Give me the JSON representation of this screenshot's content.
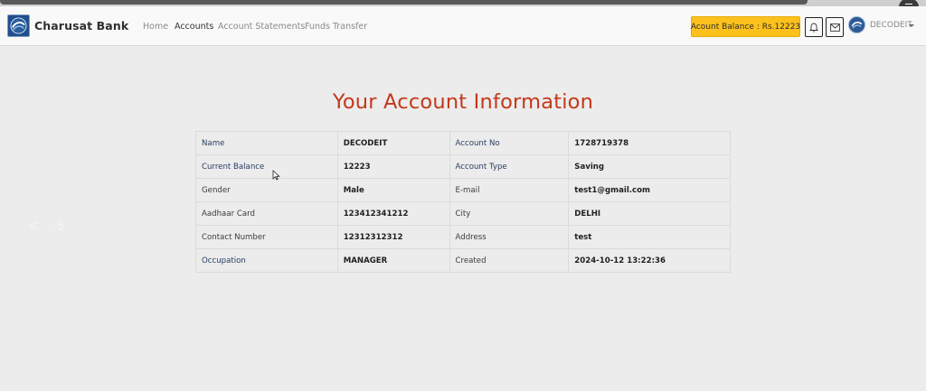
{
  "navbar": {
    "brand": "Charusat Bank",
    "links": [
      "Home",
      "Accounts",
      "Account Statements",
      "Funds Transfer"
    ],
    "active_link": "Accounts",
    "balance_label": "Acount Balance : Rs.12223",
    "user_name": "DECODEIT",
    "icons": [
      "bell-icon",
      "mail-icon",
      "bank-logo-icon",
      "caret-down-icon",
      "menu-icon"
    ]
  },
  "page": {
    "title": "Your Account Information"
  },
  "account_info": {
    "rows": [
      [
        "Name",
        "DECODEIT",
        "Account No",
        "1728719378"
      ],
      [
        "Current Balance",
        "12223",
        "Account Type",
        "Saving"
      ],
      [
        "Gender",
        "Male",
        "E-mail",
        "test1@gmail.com"
      ],
      [
        "Aadhaar Card",
        "123412341212",
        "City",
        "DELHI"
      ],
      [
        "Contact Number",
        "12312312312",
        "Address",
        "test"
      ],
      [
        "Occupation",
        "MANAGER",
        "Created",
        "2024-10-12 13:22:36"
      ]
    ]
  },
  "overlay": {
    "prev_glyph": "<",
    "count": "- 5"
  },
  "colors": {
    "title": "#c4381b",
    "balance_button": "#fcc11c",
    "page_background": "#ebeceb",
    "navbar_background": "#f8f9f8"
  }
}
